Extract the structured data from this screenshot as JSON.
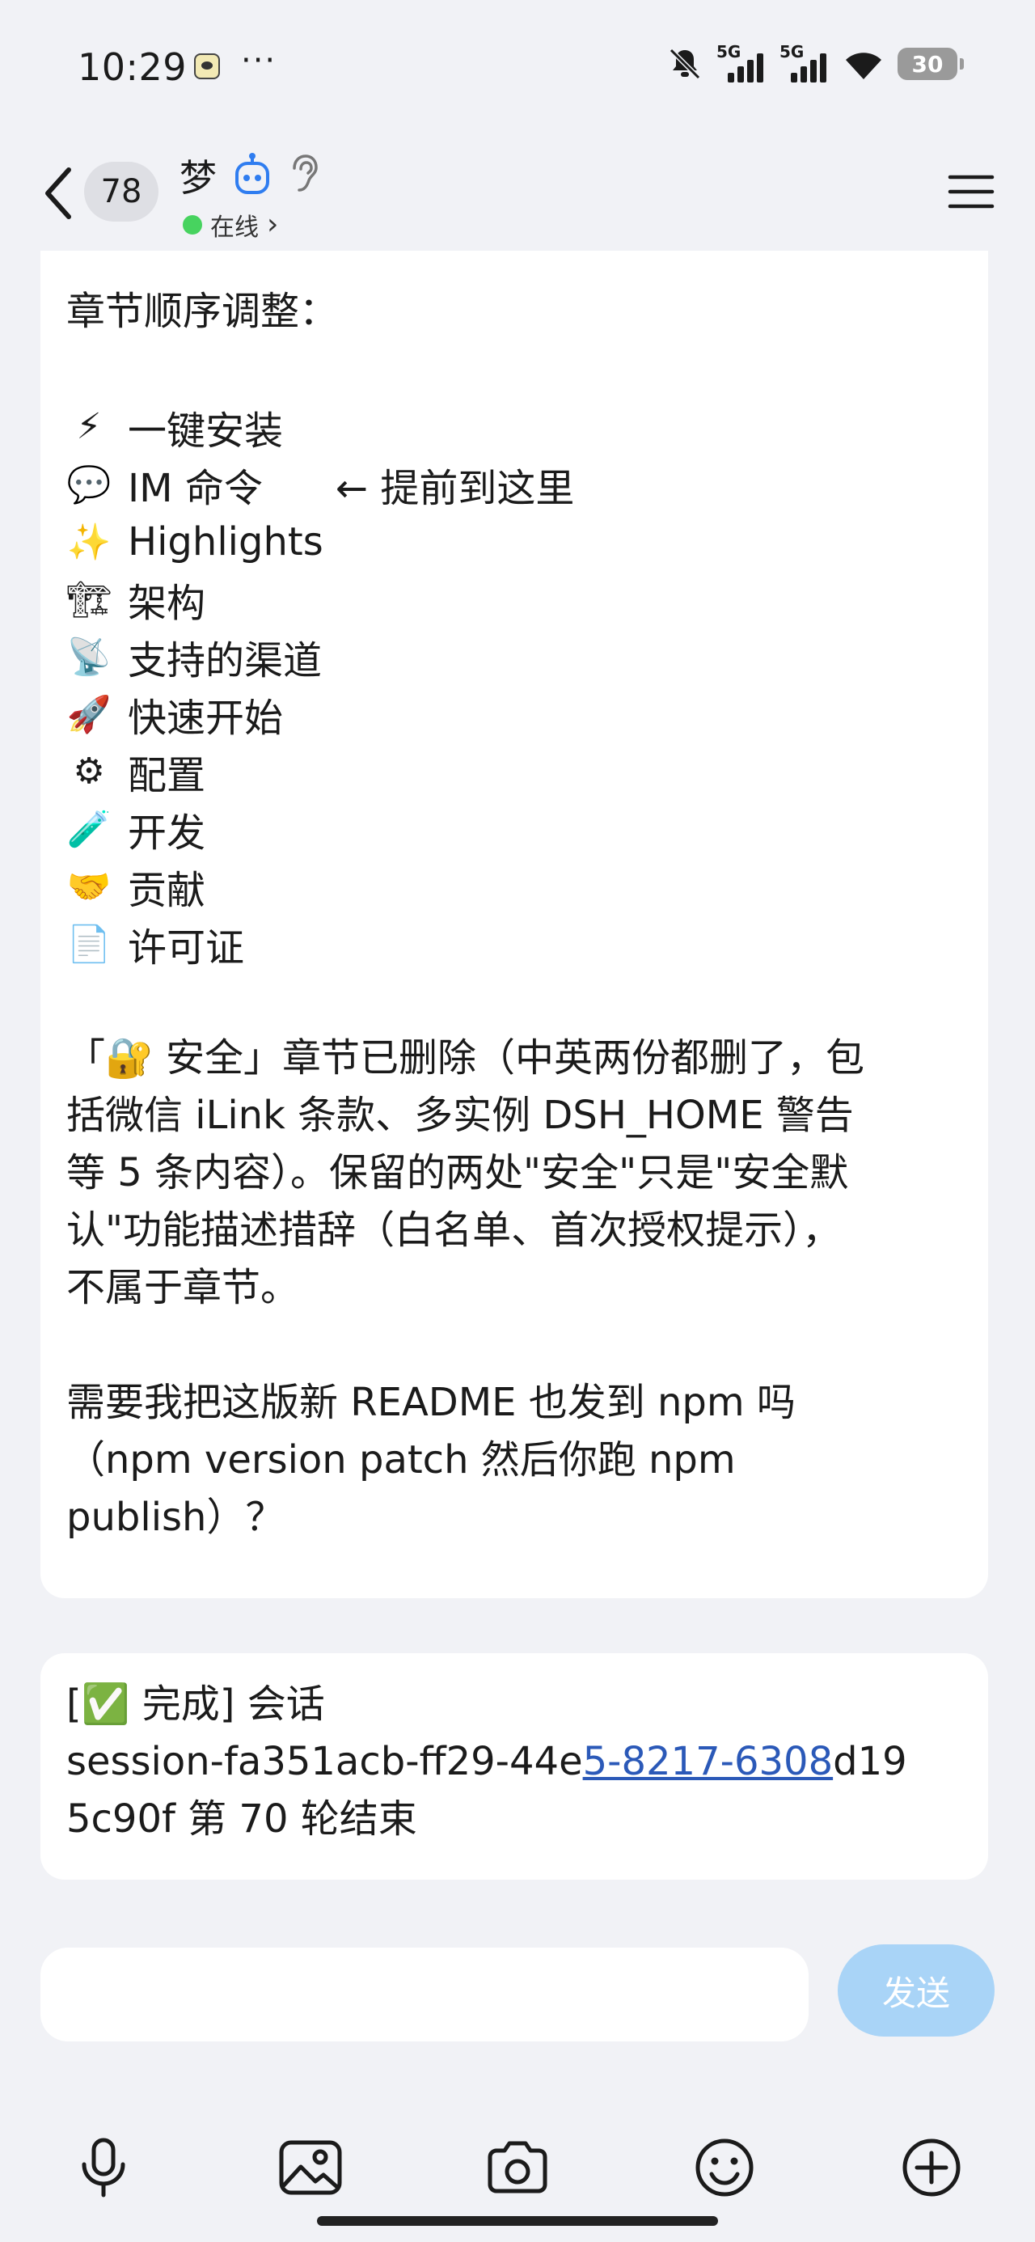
{
  "status": {
    "time": "10:29",
    "more": "···",
    "net1": "5G",
    "net2": "5G",
    "battery": "30"
  },
  "header": {
    "unread": "78",
    "name": "梦",
    "presence": "在线",
    "presence_chevron": "›"
  },
  "message1": {
    "heading": "章节顺序调整：",
    "sections": [
      {
        "emoji": "⚡",
        "label": "一键安装"
      },
      {
        "emoji": "💬",
        "label": "IM 命令"
      },
      {
        "emoji": "✨",
        "label": "Highlights"
      },
      {
        "emoji": "🏗",
        "label": "架构"
      },
      {
        "emoji": "📡",
        "label": "支持的渠道"
      },
      {
        "emoji": "🚀",
        "label": "快速开始"
      },
      {
        "emoji": "⚙",
        "label": "配置"
      },
      {
        "emoji": "🧪",
        "label": "开发"
      },
      {
        "emoji": "🤝",
        "label": "贡献"
      },
      {
        "emoji": "📄",
        "label": "许可证"
      }
    ],
    "move_note": "← 提前到这里",
    "p1_lines": [
      "「🔐 安全」章节已删除（中英两份都删了，包",
      "括微信 iLink 条款、多实例 DSH_HOME 警告",
      "等 5 条内容）。保留的两处\"安全\"只是\"安全默",
      "认\"功能描述措辞（白名单、首次授权提示），",
      "不属于章节。"
    ],
    "p2_lines": [
      "需要我把这版新 README 也发到 npm 吗",
      "（npm version patch 然后你跑 npm",
      "publish）？"
    ]
  },
  "message2": {
    "line1": "[✅ 完成] 会话",
    "line2_pre": "session-fa351acb-ff29-44e",
    "line2_link": "5-8217-6308",
    "line2_post": "d19",
    "line3": "5c90f 第 70 轮结束"
  },
  "composer": {
    "input_value": "",
    "send_label": "发送"
  },
  "colors": {
    "accent_send": "#a9d4f7",
    "online": "#47d35f",
    "link": "#2b59b8"
  },
  "icons": [
    "mic-icon",
    "image-icon",
    "camera-icon",
    "emoji-icon",
    "plus-icon"
  ]
}
